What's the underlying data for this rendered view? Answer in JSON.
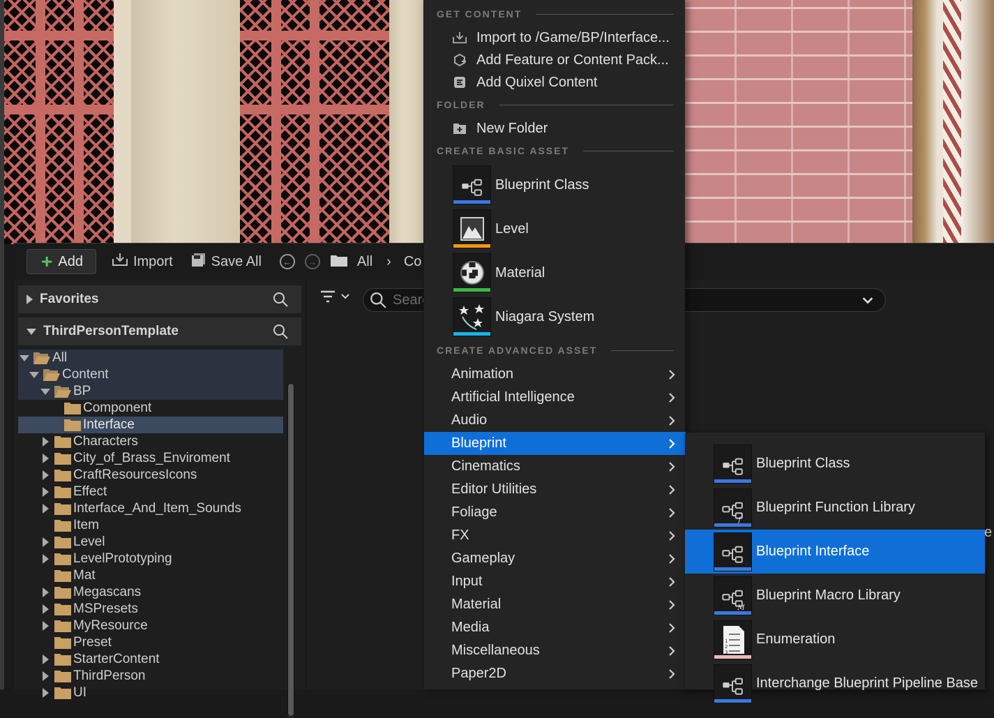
{
  "toolbar": {
    "add_label": "Add",
    "import_label": "Import",
    "save_all_label": "Save All",
    "breadcrumb_all": "All",
    "breadcrumb_next": "Co"
  },
  "sources": {
    "favorites_label": "Favorites",
    "project_label": "ThirdPersonTemplate",
    "tree": [
      {
        "label": "All",
        "depth": 0,
        "expander": "down"
      },
      {
        "label": "Content",
        "depth": 1,
        "expander": "down"
      },
      {
        "label": "BP",
        "depth": 2,
        "expander": "down"
      },
      {
        "label": "Component",
        "depth": 3,
        "expander": "none"
      },
      {
        "label": "Interface",
        "depth": 3,
        "expander": "none"
      },
      {
        "label": "Characters",
        "depth": 2,
        "expander": "right"
      },
      {
        "label": "City_of_Brass_Enviroment",
        "depth": 2,
        "expander": "right"
      },
      {
        "label": "CraftResourcesIcons",
        "depth": 2,
        "expander": "right"
      },
      {
        "label": "Effect",
        "depth": 2,
        "expander": "right"
      },
      {
        "label": "Interface_And_Item_Sounds",
        "depth": 2,
        "expander": "right"
      },
      {
        "label": "Item",
        "depth": 2,
        "expander": "none"
      },
      {
        "label": "Level",
        "depth": 2,
        "expander": "right"
      },
      {
        "label": "LevelPrototyping",
        "depth": 2,
        "expander": "right"
      },
      {
        "label": "Mat",
        "depth": 2,
        "expander": "none"
      },
      {
        "label": "Megascans",
        "depth": 2,
        "expander": "right"
      },
      {
        "label": "MSPresets",
        "depth": 2,
        "expander": "right"
      },
      {
        "label": "MyResource",
        "depth": 2,
        "expander": "right"
      },
      {
        "label": "Preset",
        "depth": 2,
        "expander": "none"
      },
      {
        "label": "StarterContent",
        "depth": 2,
        "expander": "right"
      },
      {
        "label": "ThirdPerson",
        "depth": 2,
        "expander": "right"
      },
      {
        "label": "UI",
        "depth": 2,
        "expander": "right"
      }
    ]
  },
  "main": {
    "search_placeholder": "Search"
  },
  "add_menu": {
    "get_content_header": "GET CONTENT",
    "import_label": "Import to /Game/BP/Interface...",
    "add_feature_label": "Add Feature or Content Pack...",
    "add_quixel_label": "Add Quixel Content",
    "folder_header": "FOLDER",
    "new_folder_label": "New Folder",
    "basic_header": "CREATE BASIC ASSET",
    "basic_assets": [
      {
        "label": "Blueprint Class",
        "color": "#3a78e0",
        "icon": "blueprint-class-icon"
      },
      {
        "label": "Level",
        "color": "#f29a0e",
        "icon": "level-icon"
      },
      {
        "label": "Material",
        "color": "#3cb94a",
        "icon": "material-icon"
      },
      {
        "label": "Niagara System",
        "color": "#14b6e6",
        "icon": "niagara-icon"
      }
    ],
    "advanced_header": "CREATE ADVANCED ASSET",
    "advanced_items": [
      "Animation",
      "Artificial Intelligence",
      "Audio",
      "Blueprint",
      "Cinematics",
      "Editor Utilities",
      "Foliage",
      "FX",
      "Gameplay",
      "Input",
      "Material",
      "Media",
      "Miscellaneous",
      "Paper2D"
    ],
    "active_item": "Blueprint"
  },
  "blueprint_submenu": {
    "items": [
      {
        "label": "Blueprint Class",
        "color": "#3a78e0",
        "icon": "blueprint-class-icon"
      },
      {
        "label": "Blueprint Function Library",
        "color": "#3a78e0",
        "icon": "blueprint-function-library-icon"
      },
      {
        "label": "Blueprint Interface",
        "color": "#3a78e0",
        "icon": "blueprint-interface-icon"
      },
      {
        "label": "Blueprint Macro Library",
        "color": "#3a78e0",
        "icon": "blueprint-macro-library-icon"
      },
      {
        "label": "Enumeration",
        "color": "#f0b8b8",
        "icon": "enumeration-icon"
      },
      {
        "label": "Interchange Blueprint Pipeline Base",
        "color": "#3a78e0",
        "icon": "blueprint-class-icon"
      }
    ],
    "active_item": "Blueprint Interface"
  },
  "colors": {
    "accent": "#0f6fd6",
    "selection": "#3b4a5e",
    "folder": "#c8a064",
    "add_plus": "#58c15f"
  },
  "stray_glyph": "e"
}
